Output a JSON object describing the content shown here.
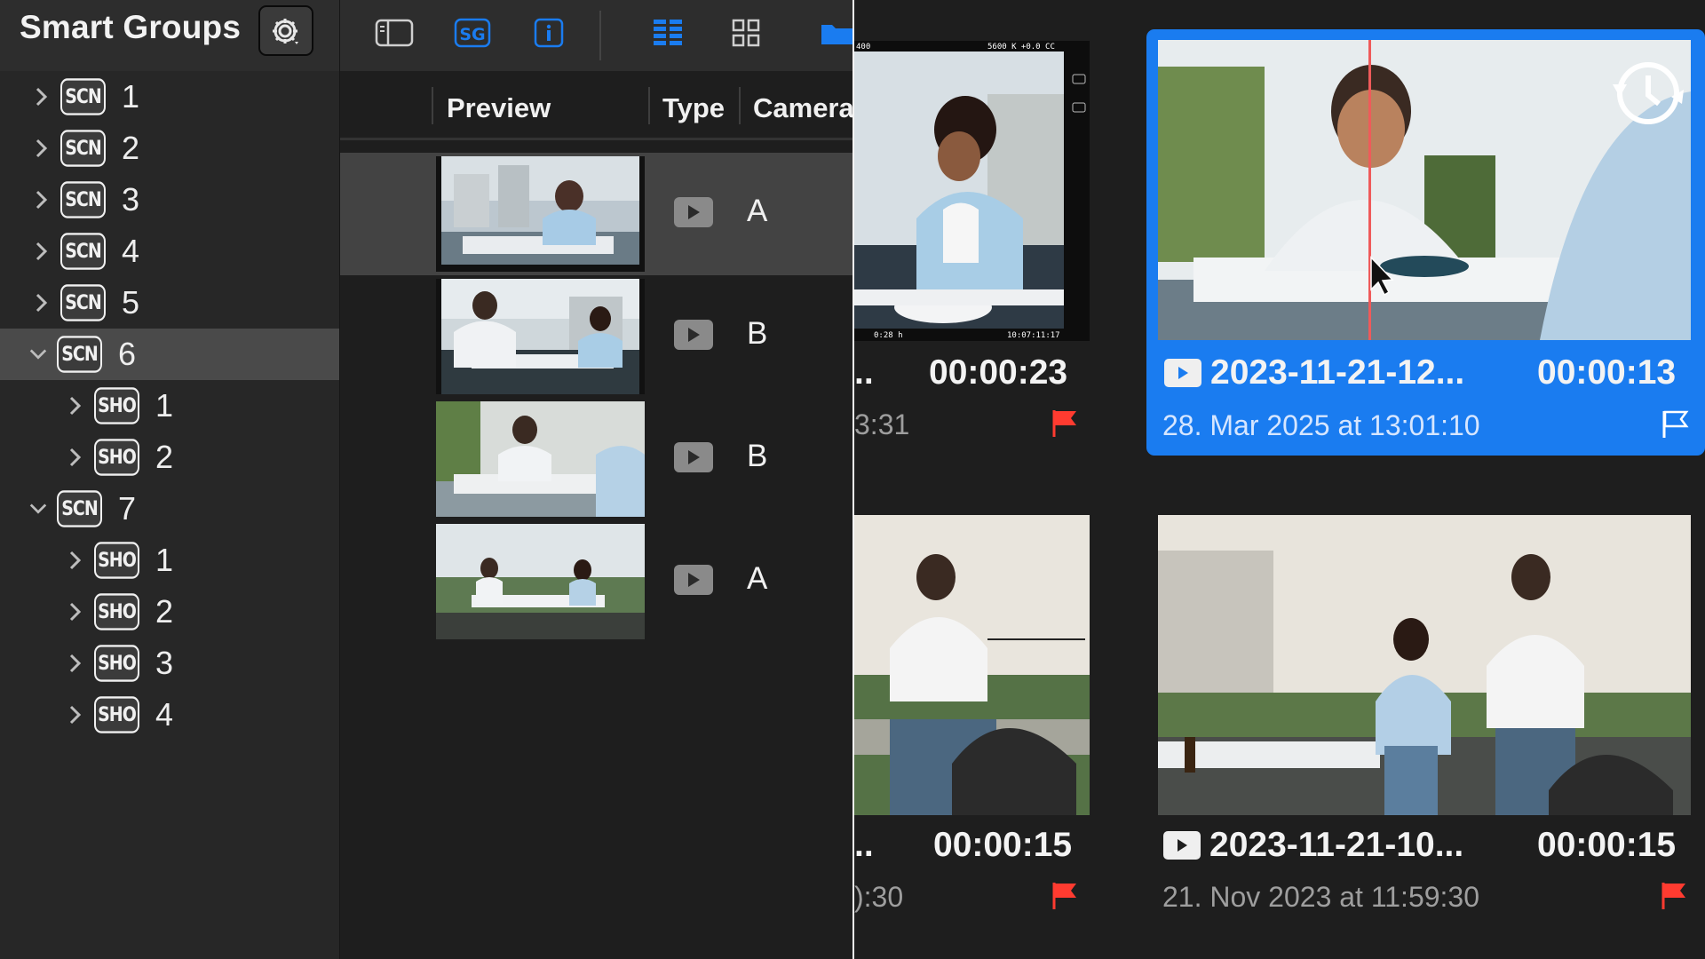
{
  "sidebar": {
    "title": "Smart Groups",
    "gear_icon": "gear-icon",
    "tree": [
      {
        "tag": "SCN",
        "number": "1",
        "level": 0,
        "expanded": false,
        "selected": false
      },
      {
        "tag": "SCN",
        "number": "2",
        "level": 0,
        "expanded": false,
        "selected": false
      },
      {
        "tag": "SCN",
        "number": "3",
        "level": 0,
        "expanded": false,
        "selected": false
      },
      {
        "tag": "SCN",
        "number": "4",
        "level": 0,
        "expanded": false,
        "selected": false
      },
      {
        "tag": "SCN",
        "number": "5",
        "level": 0,
        "expanded": false,
        "selected": false
      },
      {
        "tag": "SCN",
        "number": "6",
        "level": 0,
        "expanded": true,
        "selected": true
      },
      {
        "tag": "SHO",
        "number": "1",
        "level": 1,
        "expanded": false,
        "selected": false
      },
      {
        "tag": "SHO",
        "number": "2",
        "level": 1,
        "expanded": false,
        "selected": false
      },
      {
        "tag": "SCN",
        "number": "7",
        "level": 0,
        "expanded": true,
        "selected": false
      },
      {
        "tag": "SHO",
        "number": "1",
        "level": 1,
        "expanded": false,
        "selected": false
      },
      {
        "tag": "SHO",
        "number": "2",
        "level": 1,
        "expanded": false,
        "selected": false
      },
      {
        "tag": "SHO",
        "number": "3",
        "level": 1,
        "expanded": false,
        "selected": false
      },
      {
        "tag": "SHO",
        "number": "4",
        "level": 1,
        "expanded": false,
        "selected": false
      }
    ]
  },
  "toolbar": {
    "buttons": [
      {
        "icon": "sidebar-toggle-icon",
        "active": false
      },
      {
        "icon": "smart-groups-icon",
        "label": "SG",
        "active": true
      },
      {
        "icon": "info-icon",
        "label": "i",
        "active": true
      },
      {
        "icon": "list-view-icon",
        "active": true
      },
      {
        "icon": "grid-view-icon",
        "active": false
      },
      {
        "icon": "folder-icon",
        "active": true
      }
    ]
  },
  "list": {
    "columns": [
      "Preview",
      "Type",
      "Camera"
    ],
    "rows": [
      {
        "type_icon": "video-icon",
        "camera": "A",
        "selected": true
      },
      {
        "type_icon": "video-icon",
        "camera": "B",
        "selected": false
      },
      {
        "type_icon": "video-icon",
        "camera": "B",
        "selected": false
      },
      {
        "type_icon": "video-icon",
        "camera": "A",
        "selected": false
      }
    ]
  },
  "grid": {
    "cards": [
      {
        "name": "..",
        "duration": "00:00:23",
        "date": "3:31",
        "flag": "flag-icon",
        "flagged": true,
        "selected": false,
        "overlay": {
          "top_left": "400",
          "top_mid": "5600 K +0.0 CC",
          "bottom_left": "0:28 h",
          "bottom_right": "10:07:11:17"
        }
      },
      {
        "name": "2023-11-21-12...",
        "duration": "00:00:13",
        "date": "28. Mar 2025 at 13:01:10",
        "flag": "flag-outline-icon",
        "flagged": false,
        "selected": true,
        "badge_icon": "revert-clock-icon"
      },
      {
        "name": "..",
        "duration": "00:00:15",
        "date": "):30",
        "flag": "flag-icon",
        "flagged": true,
        "selected": false
      },
      {
        "name": "2023-11-21-10...",
        "duration": "00:00:15",
        "date": "21. Nov 2023 at 11:59:30",
        "flag": "flag-icon",
        "flagged": true,
        "selected": false
      }
    ]
  },
  "colors": {
    "accent": "#1a7cf0",
    "flag_red": "#ff3b30",
    "sidebar_bg": "#272727",
    "panel_bg": "#1e1e1e",
    "selected_row": "#4a4a4a"
  }
}
